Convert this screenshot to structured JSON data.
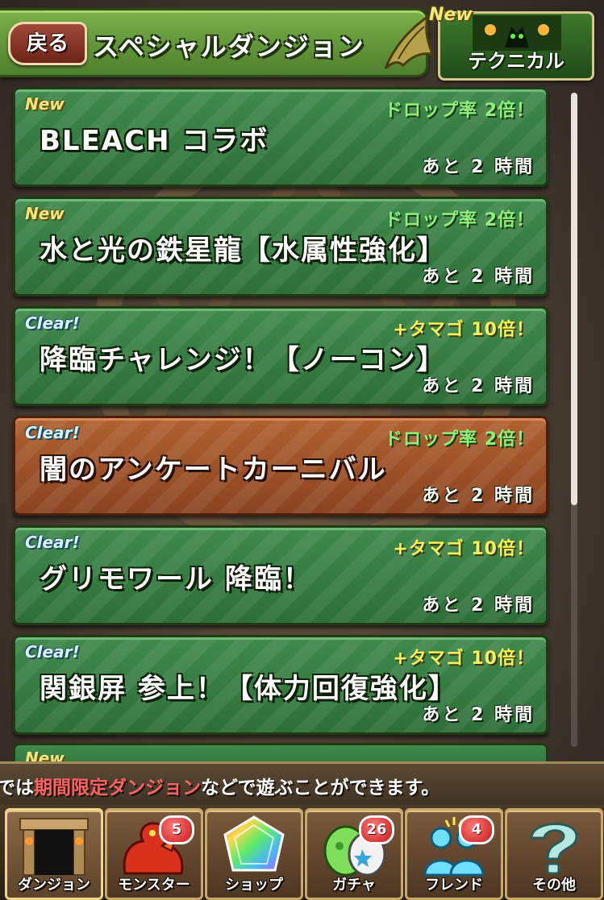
{
  "header": {
    "back_label": "戻る",
    "title": "スペシャルダンジョン",
    "technical": {
      "label": "テクニカル",
      "new_badge": "New"
    }
  },
  "dungeons": [
    {
      "badge": "New",
      "badge_type": "new",
      "bonus": "ドロップ率 2倍！",
      "bonus_type": "drop",
      "title": "BLEACH コラボ",
      "remaining": "あと 2 時間",
      "color": "green"
    },
    {
      "badge": "New",
      "badge_type": "new",
      "bonus": "ドロップ率 2倍！",
      "bonus_type": "drop",
      "title": "水と光の鉄星龍【水属性強化】",
      "remaining": "あと 2 時間",
      "color": "green"
    },
    {
      "badge": "Clear!",
      "badge_type": "clear",
      "bonus": "+タマゴ 10倍！",
      "bonus_type": "egg",
      "title": "降臨チャレンジ！【ノーコン】",
      "remaining": "あと 2 時間",
      "color": "green"
    },
    {
      "badge": "Clear!",
      "badge_type": "clear",
      "bonus": "ドロップ率 2倍！",
      "bonus_type": "drop",
      "title": "闇のアンケートカーニバル",
      "remaining": "あと 2 時間",
      "color": "brown"
    },
    {
      "badge": "Clear!",
      "badge_type": "clear",
      "bonus": "+タマゴ 10倍！",
      "bonus_type": "egg",
      "title": "グリモワール 降臨！",
      "remaining": "あと 2 時間",
      "color": "green"
    },
    {
      "badge": "Clear!",
      "badge_type": "clear",
      "bonus": "+タマゴ 10倍！",
      "bonus_type": "egg",
      "title": "関銀屏 参上！【体力回復強化】",
      "remaining": "あと 2 時間",
      "color": "green"
    }
  ],
  "peek_badge": "New",
  "message": {
    "prefix": "では",
    "highlight": "期間限定ダンジョン",
    "suffix": "などで遊ぶことができます。"
  },
  "nav": [
    {
      "label": "ダンジョン",
      "icon": "dungeon-gate-icon",
      "badge": ""
    },
    {
      "label": "モンスター",
      "icon": "red-dragon-icon",
      "badge": "5"
    },
    {
      "label": "ショップ",
      "icon": "rainbow-stone-icon",
      "badge": ""
    },
    {
      "label": "ガチャ",
      "icon": "egg-icon",
      "badge": "26"
    },
    {
      "label": "フレンド",
      "icon": "friends-icon",
      "badge": "4"
    },
    {
      "label": "その他",
      "icon": "question-mark-icon",
      "badge": ""
    }
  ],
  "colors": {
    "card_green": "#3f8a4c",
    "card_brown": "#b0612f",
    "new_badge": "#f0e77c",
    "clear_badge": "#d7f3ff",
    "drop_bonus": "#8ff07c",
    "egg_bonus": "#f6f25a",
    "message_highlight": "#ff6262",
    "notification_badge": "#c81818"
  },
  "scroll": {
    "thumb_fraction": 0.63
  }
}
